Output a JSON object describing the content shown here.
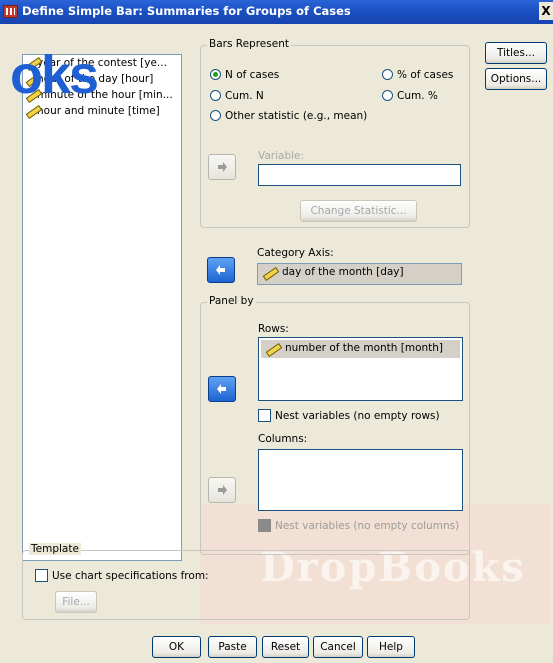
{
  "window": {
    "title": "Define Simple Bar: Summaries for Groups of Cases",
    "close_glyph": "X"
  },
  "watermark": {
    "text": "DropBooks",
    "overlay_text": "oks"
  },
  "variables": [
    {
      "label": "year of the contest [ye...",
      "icon": "ruler-icon"
    },
    {
      "label": "hour of the day [hour]",
      "icon": "ruler-icon"
    },
    {
      "label": "minute of the hour [min...",
      "icon": "ruler-icon"
    },
    {
      "label": "hour and minute [time]",
      "icon": "ruler-icon"
    }
  ],
  "bars_represent": {
    "legend": "Bars Represent",
    "n_of_cases": "N of cases",
    "pct_of_cases": "% of cases",
    "cum_n": "Cum. N",
    "cum_pct": "Cum. %",
    "other_statistic": "Other statistic (e.g., mean)",
    "selected": "n_of_cases",
    "variable_label": "Variable:",
    "variable_value": "",
    "change_statistic": "Change Statistic..."
  },
  "category_axis": {
    "label": "Category Axis:",
    "value": "day of the month [day]"
  },
  "panel_by": {
    "legend": "Panel by",
    "rows_label": "Rows:",
    "rows_value": "number of the month [month]",
    "nest_rows": "Nest variables (no empty rows)",
    "columns_label": "Columns:",
    "nest_columns": "Nest variables (no empty columns)"
  },
  "template": {
    "legend": "Template",
    "use_chart_spec": "Use chart specifications from:",
    "file_button": "File..."
  },
  "side_buttons": {
    "titles": "Titles...",
    "options": "Options..."
  },
  "bottom_buttons": {
    "ok": "OK",
    "paste": "Paste",
    "reset": "Reset",
    "cancel": "Cancel",
    "help": "Help"
  },
  "colors": {
    "title_bar": "#1a4fc0",
    "accent_arrow": "#1d64d3",
    "watermark_text": "#1f5fd4"
  }
}
